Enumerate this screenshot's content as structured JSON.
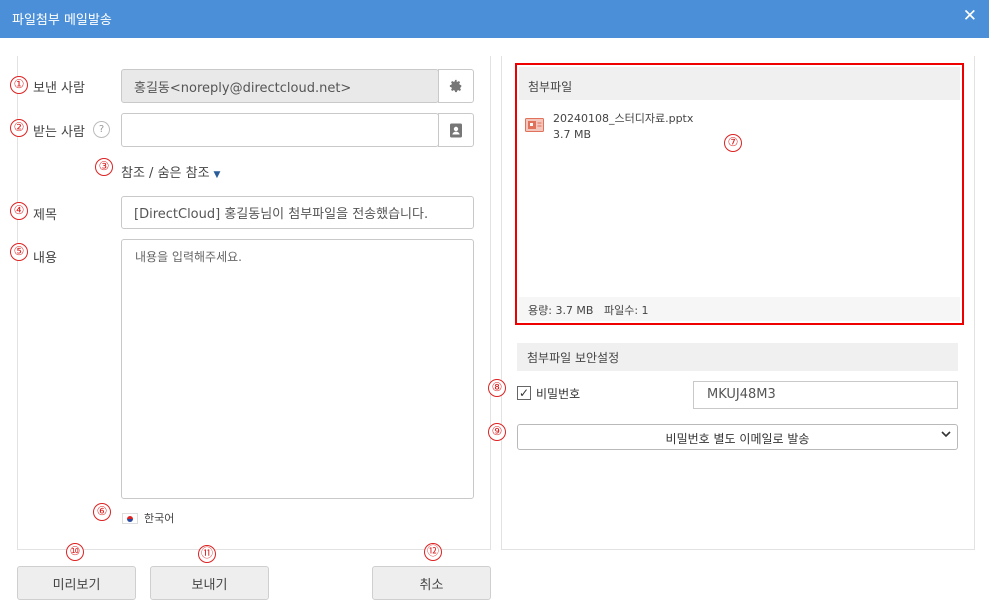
{
  "window": {
    "title": "파일첨부 메일발송",
    "close_glyph": "✕"
  },
  "form": {
    "sender": {
      "label": "보낸 사람",
      "value": "홍길동<noreply@directcloud.net>",
      "icon": "gear-icon"
    },
    "recipient": {
      "label": "받는 사람",
      "value": "",
      "help": "?",
      "icon": "address-book-icon"
    },
    "cc_toggle": {
      "label": "참조 / 숨은 참조",
      "caret": "▼"
    },
    "subject": {
      "label": "제목",
      "value": "[DirectCloud] 홍길동님이 첨부파일을 전송했습니다."
    },
    "body": {
      "label": "내용",
      "placeholder": "내용을 입력해주세요."
    },
    "language": {
      "label": "한국어",
      "icon": "korea-flag-icon"
    }
  },
  "buttons": {
    "preview": "미리보기",
    "send": "보내기",
    "cancel": "취소"
  },
  "attachments": {
    "header": "첨부파일",
    "files": [
      {
        "name": "20240108_스터디자료.pptx",
        "size": "3.7 MB",
        "icon": "pptx-file-icon"
      }
    ],
    "footer": "용량: 3.7 MB   파일수: 1"
  },
  "security": {
    "header": "첨부파일 보안설정",
    "password_checkbox": {
      "checked": true,
      "glyph": "✓",
      "label": "비밀번호"
    },
    "password_value": "MKUJ48M3",
    "delivery_option": {
      "selected": "비밀번호 별도 이메일로 발송",
      "arrow": "⌄"
    }
  },
  "annotations": [
    "①",
    "②",
    "③",
    "④",
    "⑤",
    "⑥",
    "⑦",
    "⑧",
    "⑨",
    "⑩",
    "⑪",
    "⑫"
  ],
  "colors": {
    "titlebar": "#4a8fd8",
    "annotation_red": "#dd2222"
  }
}
